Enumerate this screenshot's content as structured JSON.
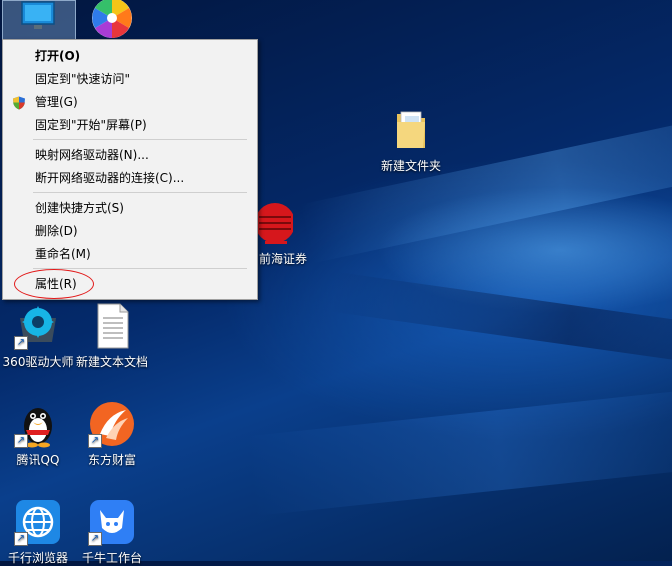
{
  "context_menu": {
    "items": [
      {
        "label": "打开(O)",
        "bold": true
      },
      {
        "label": "固定到\"快速访问\""
      },
      {
        "label": "管理(G)",
        "icon": "uac-shield-icon"
      },
      {
        "label": "固定到\"开始\"屏幕(P)"
      },
      {
        "label": "映射网络驱动器(N)..."
      },
      {
        "label": "断开网络驱动器的连接(C)..."
      },
      {
        "label": "创建快捷方式(S)"
      },
      {
        "label": "删除(D)"
      },
      {
        "label": "重命名(M)"
      },
      {
        "label": "属性(R)",
        "highlighted": true
      }
    ]
  },
  "desktop": {
    "icons": [
      {
        "label": "新建文件夹",
        "icon": "folder-icon"
      },
      {
        "label": "前海证券",
        "icon": "qianhai-securities-icon"
      },
      {
        "label": "360驱动大师",
        "icon": "driver-master-icon"
      },
      {
        "label": "新建文本文档",
        "icon": "text-document-icon"
      },
      {
        "label": "腾讯QQ",
        "icon": "qq-penguin-icon"
      },
      {
        "label": "东方财富",
        "icon": "eastmoney-icon"
      },
      {
        "label": "千行浏览器",
        "icon": "browser-globe-icon"
      },
      {
        "label": "千牛工作台",
        "icon": "qianniu-icon"
      }
    ]
  },
  "colors": {
    "menu_bg": "#f2f2f2",
    "highlight_circle": "#e21b1b",
    "desktop_bg": "#0a3f8c"
  }
}
